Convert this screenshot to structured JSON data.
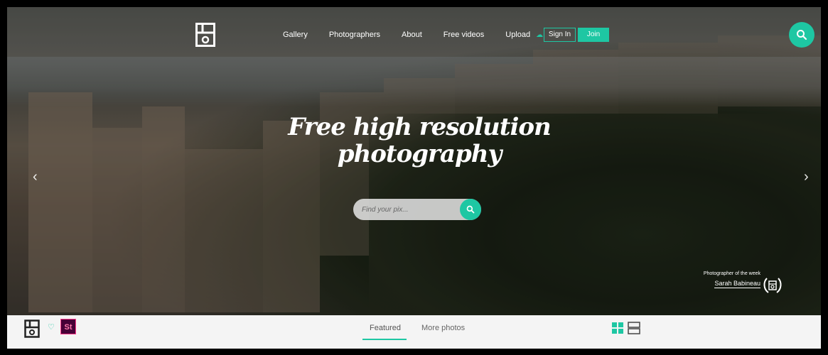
{
  "nav": {
    "items": [
      {
        "label": "Gallery"
      },
      {
        "label": "Photographers"
      },
      {
        "label": "About"
      },
      {
        "label": "Free videos"
      }
    ],
    "upload_label": "Upload",
    "signin_label": "Sign In",
    "join_label": "Join"
  },
  "hero": {
    "headline_line1": "Free high resolution",
    "headline_line2": "photography",
    "search_placeholder": "Find your pix..."
  },
  "photographer_of_week": {
    "label": "Photographer of the week",
    "name": "Sarah Babineau"
  },
  "bottom_bar": {
    "badge_text": "St",
    "tabs": [
      {
        "label": "Featured",
        "active": true
      },
      {
        "label": "More photos",
        "active": false
      }
    ]
  },
  "colors": {
    "accent": "#1ec7a3"
  },
  "icons": [
    "logo-icon",
    "cloud-upload-icon",
    "search-icon",
    "chevron-left-icon",
    "chevron-right-icon",
    "laurel-icon",
    "heart-icon",
    "grid-view-icon",
    "list-view-icon"
  ]
}
